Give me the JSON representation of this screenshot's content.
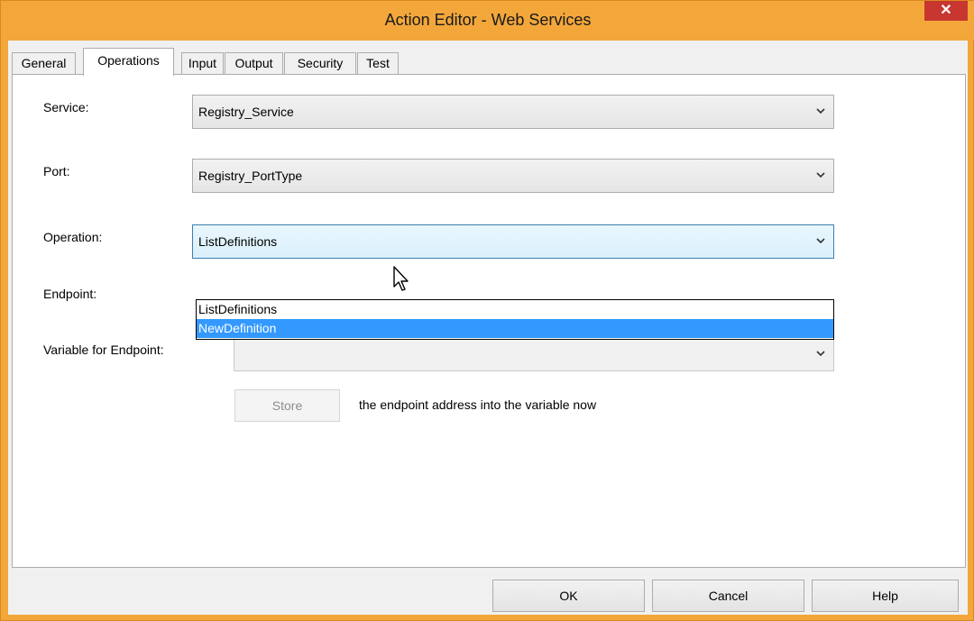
{
  "window": {
    "title": "Action Editor - Web Services",
    "close_glyph": "✕"
  },
  "tabs": [
    {
      "label": "General"
    },
    {
      "label": "Operations"
    },
    {
      "label": "Input"
    },
    {
      "label": "Output"
    },
    {
      "label": "Security"
    },
    {
      "label": "Test"
    }
  ],
  "active_tab": "Operations",
  "form": {
    "service_label": "Service:",
    "service_value": "Registry_Service",
    "port_label": "Port:",
    "port_value": "Registry_PortType",
    "operation_label": "Operation:",
    "operation_value": "ListDefinitions",
    "operation_options": [
      "ListDefinitions",
      "NewDefinition"
    ],
    "operation_highlighted": "NewDefinition",
    "endpoint_label": "Endpoint:",
    "variable_label": "Variable for Endpoint:",
    "variable_value": "",
    "store_button": "Store",
    "store_text": "the endpoint address into the variable now"
  },
  "buttons": {
    "ok": "OK",
    "cancel": "Cancel",
    "help": "Help"
  },
  "icons": {
    "dropdown": "chevron-down-icon",
    "cursor": "mouse-pointer-icon",
    "close": "close-icon"
  },
  "colors": {
    "title_bar": "#f3a73b",
    "close_button": "#c7372f",
    "selection": "#3399ff"
  }
}
